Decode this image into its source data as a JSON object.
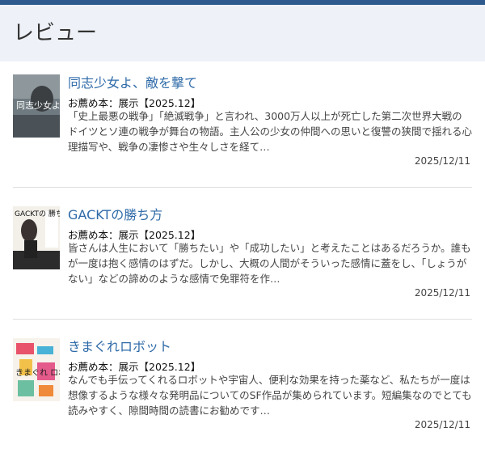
{
  "header": {
    "title": "レビュー"
  },
  "reviews": [
    {
      "title": "同志少女よ、敵を撃て",
      "tag": "お薦め本：展示【2025.12】",
      "desc": "「史上最悪の戦争」「絶滅戦争」と言われ、3000万人以上が死亡した第二次世界大戦のドイツとソ連の戦争が舞台の物語。主人公の少女の仲間への思いと復讐の狭間で揺れる心理描写や、戦争の凄惨さや生々しさを経て…",
      "date": "2025/12/11",
      "cover_text": "同志少女よ\n敵を撃て"
    },
    {
      "title": "GACKTの勝ち方",
      "tag": "お薦め本：展示【2025.12】",
      "desc": "皆さんは人生において「勝ちたい」や「成功したい」と考えたことはあるだろうか。誰もが一度は抱く感情のはずだ。しかし、大概の人間がそういった感情に蓋をし、「しょうがない」などの諦めのような感情で免罪符を作…",
      "date": "2025/12/11",
      "cover_text": "GACKTの\n勝ち方"
    },
    {
      "title": "きまぐれロボット",
      "tag": "お薦め本：展示【2025.12】",
      "desc": "なんでも手伝ってくれるロボットや宇宙人、便利な効果を持った薬など、私たちが一度は想像するような様々な発明品についてのSF作品が集められています。短編集なのでとても読みやすく、隙間時間の読書にお勧めです…",
      "date": "2025/12/11",
      "cover_text": "きまぐれ\nロボット"
    }
  ]
}
